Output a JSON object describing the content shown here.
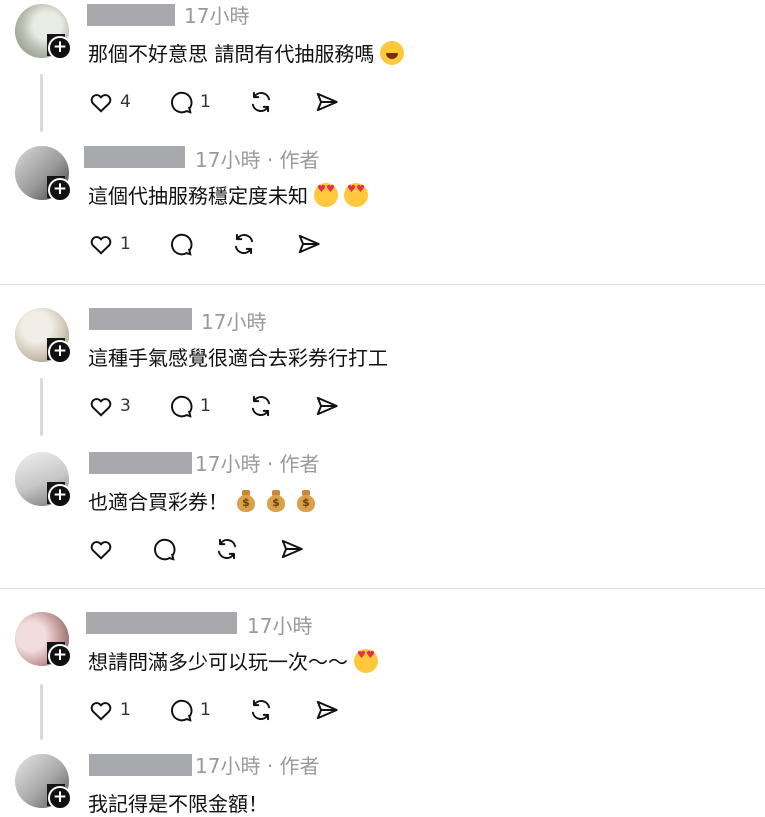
{
  "posts": [
    {
      "time": "17小時",
      "author_tag": "",
      "text": "那個不好意思 請問有代抽服務嗎",
      "emojis": [
        "laugh"
      ],
      "likes": "4",
      "replies": "1"
    },
    {
      "time": "17小時",
      "author_tag": "· 作者",
      "text": "這個代抽服務穩定度未知",
      "emojis": [
        "heart-eyes",
        "heart-eyes"
      ],
      "likes": "1",
      "replies": ""
    },
    {
      "time": "17小時",
      "author_tag": "",
      "text": "這種手氣感覺很適合去彩券行打工",
      "emojis": [],
      "likes": "3",
      "replies": "1"
    },
    {
      "time": "17小時",
      "author_tag": "· 作者",
      "text": "也適合買彩券！",
      "emojis": [
        "money-bag",
        "money-bag",
        "money-bag"
      ],
      "likes": "",
      "replies": ""
    },
    {
      "time": "17小時",
      "author_tag": "",
      "text": "想請問滿多少可以玩一次～～",
      "emojis": [
        "heart-eyes"
      ],
      "likes": "1",
      "replies": "1"
    },
    {
      "time": "17小時",
      "author_tag": "· 作者",
      "text": "我記得是不限金額！",
      "emojis": [],
      "likes": "",
      "replies": ""
    }
  ],
  "icons": {
    "like": "heart-icon",
    "reply": "comment-bubble-icon",
    "repost": "repost-icon",
    "share": "send-icon",
    "follow": "plus-icon"
  },
  "colors": {
    "meta": "#9a9a9a",
    "redaction": "#a8a9ad",
    "divider": "#dcdcdc",
    "text": "#111111"
  }
}
